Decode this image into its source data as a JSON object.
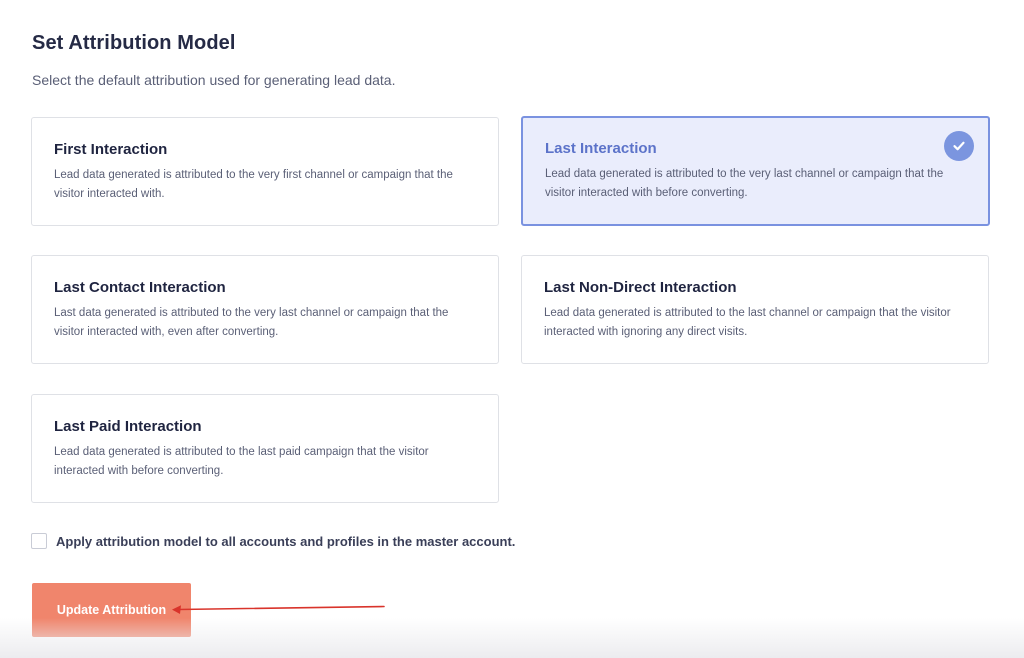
{
  "header": {
    "title": "Set Attribution Model",
    "subtitle": "Select the default attribution used for generating lead data."
  },
  "options": [
    {
      "title": "First Interaction",
      "description": "Lead data generated is attributed to the very first channel or campaign that the visitor interacted with.",
      "selected": false
    },
    {
      "title": "Last Interaction",
      "description": "Lead data generated is attributed to the very last channel or campaign that the visitor interacted with before converting.",
      "selected": true
    },
    {
      "title": "Last Contact Interaction",
      "description": "Last data generated is attributed to the very last channel or campaign that the visitor interacted with, even after converting.",
      "selected": false
    },
    {
      "title": "Last Non-Direct Interaction",
      "description": "Lead data generated is attributed to the last channel or campaign that the visitor interacted with ignoring any direct visits.",
      "selected": false
    },
    {
      "title": "Last Paid Interaction",
      "description": "Lead data generated is attributed to the last paid campaign that the visitor interacted with before converting.",
      "selected": false
    }
  ],
  "apply_all": {
    "label": "Apply attribution model to all accounts and profiles in the master account.",
    "checked": false
  },
  "update_button": {
    "label": "Update Attribution"
  },
  "icons": {
    "selected_check": "check-circle-icon",
    "annotation": "red-arrow-icon"
  },
  "colors": {
    "selected_accent": "#7b95df",
    "selected_background": "#eaedfc",
    "button": "#f0856c",
    "annotation_arrow": "#d9342b"
  }
}
